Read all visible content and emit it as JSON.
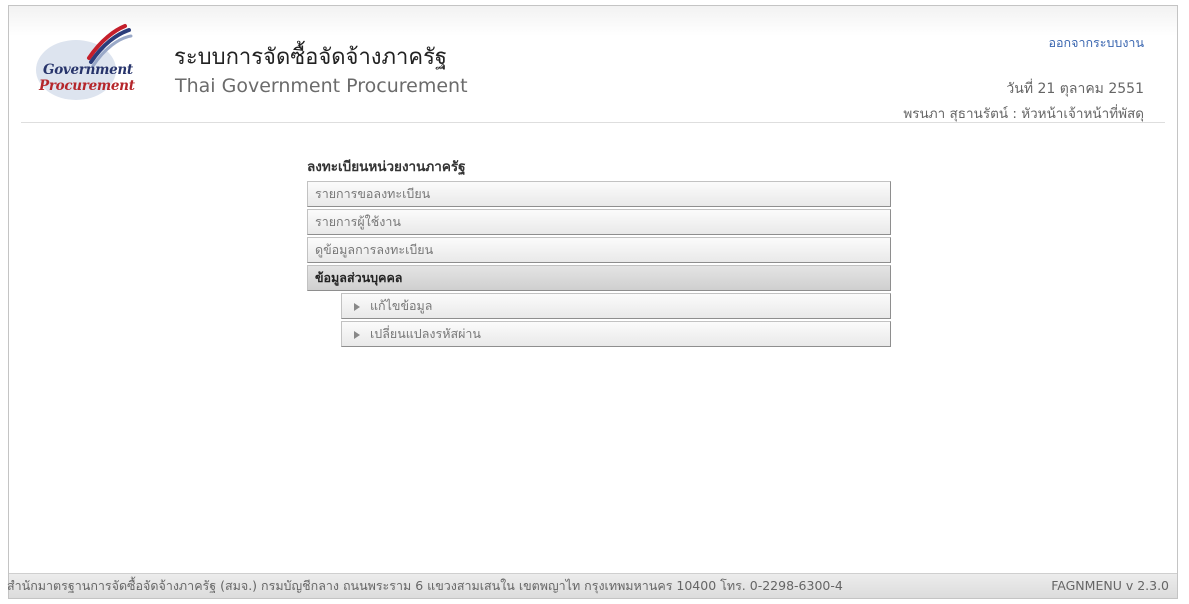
{
  "header": {
    "logo_line1": "Government",
    "logo_line2": "Procurement",
    "title_th": "ระบบการจัดซื้อจัดจ้างภาครัฐ",
    "title_en": "Thai Government Procurement",
    "logout_label": "ออกจากระบบงาน",
    "date": "วันที่ 21 ตุลาคม 2551",
    "user": "พรนภา สุธานรัตน์ : หัวหน้าเจ้าหน้าที่พัสดุ",
    "colors": {
      "logo_blue": "#27346b",
      "logo_red": "#b5262b",
      "link": "#3a66b0"
    }
  },
  "menu": {
    "title": "ลงทะเบียนหน่วยงานภาครัฐ",
    "items": [
      {
        "label": "รายการขอลงทะเบียน"
      },
      {
        "label": "รายการผู้ใช้งาน"
      },
      {
        "label": "ดูข้อมูลการลงทะเบียน"
      },
      {
        "label": "ข้อมูลส่วนบุคคล"
      }
    ],
    "subitems": [
      {
        "label": "แก้ไขข้อมูล",
        "icon": "triangle-right-icon"
      },
      {
        "label": "เปลี่ยนแปลงรหัสผ่าน",
        "icon": "triangle-right-icon"
      }
    ]
  },
  "footer": {
    "address": "สำนักมาตรฐานการจัดซื้อจัดจ้างภาครัฐ (สมจ.) กรมบัญชีกลาง ถนนพระราม 6 แขวงสามเสนใน เขตพญาไท กรุงเทพมหานคร 10400 โทร. 0-2298-6300-4",
    "version": "FAGNMENU v 2.3.0"
  }
}
